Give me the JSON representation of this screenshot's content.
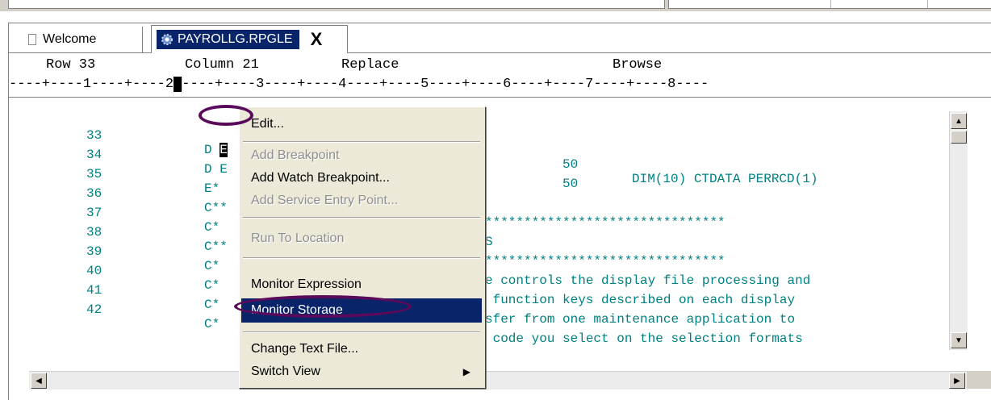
{
  "tabs": {
    "welcome": "Welcome",
    "active": "PAYROLLG.RPGLE",
    "close": "X"
  },
  "status": {
    "row": "Row 33",
    "column": "Column 21",
    "mode": "Replace",
    "view": "Browse"
  },
  "ruler": {
    "before_cursor": "----+----1----+----2",
    "cursor": "█",
    "after_cursor": "----+----3----+----4----+----5----+----6----+----7----+----8----"
  },
  "code_lines": [
    {
      "num": "33",
      "a": "D E",
      "b": "50",
      "c": "DIM(10) CTDATA PERRCD(1)"
    },
    {
      "num": "34",
      "a": "D E",
      "b": "50",
      "c": ""
    },
    {
      "num": "35",
      "a": "E*",
      "b": "",
      "c": ""
    },
    {
      "num": "36",
      "a": "C**",
      "b": "*******************************",
      "c": ""
    },
    {
      "num": "37",
      "a": "C*",
      "b": "S",
      "c": ""
    },
    {
      "num": "38",
      "a": "C**",
      "b": "*******************************",
      "c": ""
    },
    {
      "num": "39",
      "a": "C*",
      "b": "e controls the display file processing and",
      "c": ""
    },
    {
      "num": "40",
      "a": "C*",
      "b": " function keys described on each display",
      "c": ""
    },
    {
      "num": "41",
      "a": "C*",
      "b": "sfer from one maintenance application to",
      "c": ""
    },
    {
      "num": "42",
      "a": "C*",
      "b": " code you select on the selection formats",
      "c": ""
    }
  ],
  "context_menu": {
    "items": [
      {
        "label": "Edit...",
        "enabled": true
      },
      {
        "label": "Add Breakpoint",
        "enabled": false
      },
      {
        "label": "Add Watch Breakpoint...",
        "enabled": true
      },
      {
        "label": "Add Service Entry Point...",
        "enabled": false
      },
      {
        "label": "Run To Location",
        "enabled": false
      },
      {
        "label": "Monitor Expression",
        "enabled": true
      },
      {
        "label": "Monitor Storage",
        "enabled": true,
        "selected": true
      },
      {
        "label": "Change Text File...",
        "enabled": true
      },
      {
        "label": "Switch View",
        "enabled": true,
        "submenu": true
      }
    ]
  },
  "colors": {
    "code_text": "#008080",
    "selection": "#0a246a",
    "annotation": "#5a0a5a",
    "menu_bg": "#ece9d8"
  },
  "icons": {
    "welcome_tab": "document-icon",
    "active_tab": "gear-source-icon",
    "submenu": "chevron-right-icon"
  }
}
